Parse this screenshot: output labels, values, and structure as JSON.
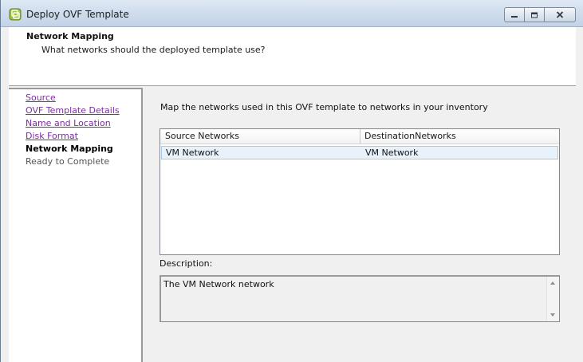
{
  "window": {
    "title": "Deploy OVF Template",
    "icon": "ovf-deploy-icon"
  },
  "header": {
    "title": "Network Mapping",
    "subtitle": "What networks should the deployed template use?"
  },
  "steps": [
    {
      "label": "Source",
      "state": "completed-link"
    },
    {
      "label": "OVF Template Details",
      "state": "completed-link"
    },
    {
      "label": "Name and Location",
      "state": "completed-link"
    },
    {
      "label": "Disk Format",
      "state": "completed-link"
    },
    {
      "label": "Network Mapping",
      "state": "current"
    },
    {
      "label": "Ready to Complete",
      "state": "pending"
    }
  ],
  "main": {
    "instruction": "Map the networks used in this OVF template to networks in your inventory",
    "table": {
      "columns": [
        "Source Networks",
        "DestinationNetworks"
      ],
      "rows": [
        {
          "source": "VM Network",
          "destination": "VM Network"
        }
      ]
    },
    "description_label": "Description:",
    "description_text": "The VM Network network"
  },
  "colors": {
    "link": "#7a2da0",
    "selected_row": "#e9f1fb",
    "selected_row_border": "#a8c8ea",
    "titlebar": "#cfdcec"
  }
}
